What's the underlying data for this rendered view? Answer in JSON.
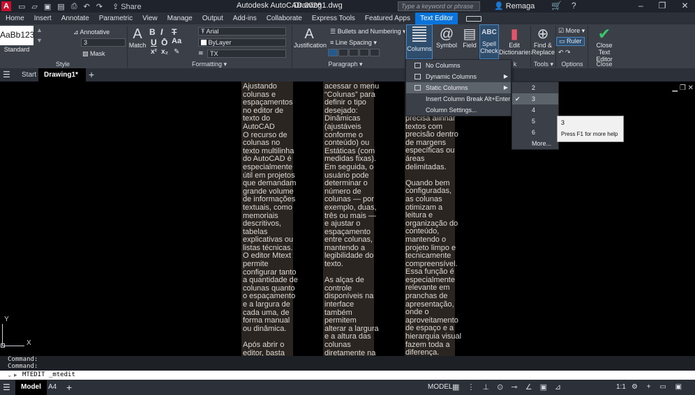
{
  "titlebar": {
    "logo": "A",
    "share": "Share",
    "app_name": "Autodesk AutoCAD 2026",
    "file_name": "Drawing1.dwg",
    "search_placeholder": "Type a keyword or phrase",
    "user": "Remaga"
  },
  "menu_tabs": [
    "Home",
    "Insert",
    "Annotate",
    "Parametric",
    "View",
    "Manage",
    "Output",
    "Add-ins",
    "Collaborate",
    "Express Tools",
    "Featured Apps",
    "Text Editor"
  ],
  "ribbon": {
    "style": {
      "sample": "AaBb123",
      "name": "Standard",
      "annotative": "Annotative",
      "height_value": "3",
      "mask": "Mask",
      "panel": "Style"
    },
    "formatting": {
      "match": "Match",
      "bold": "B",
      "italic": "I",
      "strike": "T",
      "underline": "U",
      "overline": "Ō",
      "font": "Arial",
      "color": "ByLayer",
      "fx": "TX",
      "panel": "Formatting"
    },
    "paragraph": {
      "justification": "Justification",
      "bullets": "Bullets and Numbering",
      "line_spacing": "Line Spacing",
      "panel": "Paragraph"
    },
    "insert": {
      "columns": "Columns",
      "symbol": "Symbol",
      "field": "Field"
    },
    "spell": {
      "spell_check_1": "Spell",
      "spell_check_2": "Check",
      "edit_dict_1": "Edit",
      "edit_dict_2": "Dictionaries",
      "panel_suffix": "k"
    },
    "tools": {
      "find_1": "Find &",
      "find_2": "Replace",
      "panel": "Tools"
    },
    "options": {
      "more": "More",
      "ruler": "Ruler",
      "panel": "Options"
    },
    "close": {
      "label_1": "Close",
      "label_2": "Text Editor",
      "panel": "Close"
    }
  },
  "file_tabs": {
    "start": "Start",
    "drawing": "Drawing1*"
  },
  "columns_text": {
    "col1": "Ajustando\ncolunas e\nespaçamentos\nno editor de\ntexto do\nAutoCAD\nO recurso de\ncolunas no\ntexto multilinha\ndo AutoCAD é\nespecialmente\nútil em projetos\nque demandam\ngrande volume\nde informações\ntextuais, como\nmemoriais\ndescritivos,\ntabelas\nexplicativas ou\nlistas técnicas.\nO editor Mtext\npermite\nconfigurar tanto\na quantidade de\ncolunas quanto\no espaçamento\ne a largura de\ncada uma, de\nforma manual\nou dinâmica.\n\nApós abrir o\neditor, basta",
    "col2": "acessar o menu\n“Colunas” para\ndefinir o tipo\ndesejado:\nDinâmicas\n(ajustáveis\nconforme o\nconteúdo) ou\nEstáticas (com\nmedidas fixas).\nEm seguida, o\nusuário pode\ndeterminar o\nnúmero de\ncolunas — por\nexemplo, duas,\ntrês ou mais —\ne ajustar o\nespaçamento\nentre colunas,\nmantendo a\nlegibilidade do\ntexto.\n\nAs alças de\ncontrole\ndisponíveis na\ninterface\ntambém\npermitem\nalterar a largura\ne a altura das\ncolunas\ndiretamente na",
    "col3": "precisa alinhar\ntextos com\nprecisão dentro\nde margens\nespecíficas ou\náreas\ndelimitadas.\n\nQuando bem\nconfiguradas,\nas colunas\notimizam a\nleitura e\norganização do\nconteúdo,\nmantendo o\nprojeto limpo e\ntecnicamente\ncompreensível.\nEssa função é\nespecialmente\nrelevante em\npranchas de\napresentação,\nonde o\naproveitamento\nde espaço e a\nhierarquia visual\nfazem toda a\ndiferença."
  },
  "ucs": {
    "x": "X",
    "y": "Y"
  },
  "columns_menu": {
    "items": [
      "No Columns",
      "Dynamic Columns",
      "Static Columns",
      "Insert Column Break Alt+Enter",
      "Column Settings..."
    ]
  },
  "static_submenu": {
    "items": [
      "2",
      "3",
      "4",
      "5",
      "6",
      "More..."
    ],
    "checked": "3"
  },
  "tooltip": {
    "title": "3",
    "help": "Press F1 for more help"
  },
  "command": {
    "history_1": "Command:",
    "history_2": "Command:",
    "current": "MTEDIT _mtedit"
  },
  "statusbar": {
    "model_tab": "Model",
    "layout_tab": "A4",
    "model_label": "MODEL",
    "scale": "1:1"
  }
}
